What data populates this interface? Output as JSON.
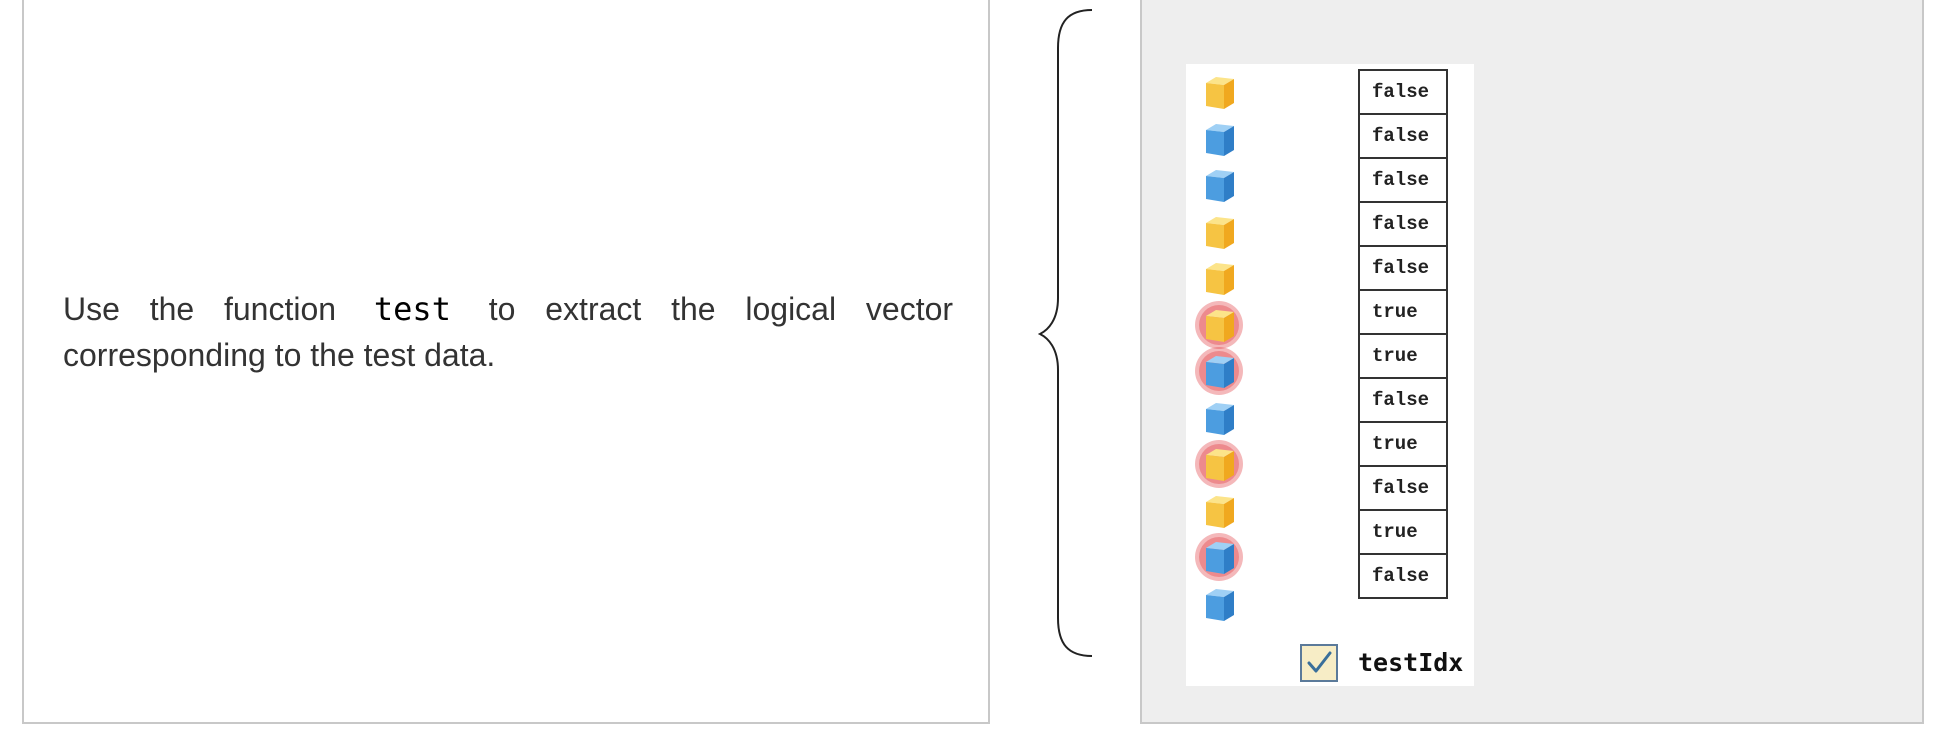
{
  "instruction": {
    "before": "Use the function",
    "code": "test",
    "after": "to extract the logical vector corresponding to the test data."
  },
  "vector": {
    "values": [
      "false",
      "false",
      "false",
      "false",
      "false",
      "true",
      "true",
      "false",
      "true",
      "false",
      "true",
      "false"
    ],
    "cube_colors": [
      "yellow",
      "blue",
      "blue",
      "yellow",
      "yellow",
      "yellow",
      "blue",
      "blue",
      "yellow",
      "yellow",
      "blue",
      "blue"
    ],
    "highlighted": [
      false,
      false,
      false,
      false,
      false,
      true,
      true,
      false,
      true,
      false,
      true,
      false
    ],
    "colors": {
      "yellow": "#f5b82e",
      "blue": "#3d8fd6",
      "highlight": "#e0353a"
    }
  },
  "variable": {
    "name": "testIdx",
    "icon": "checkbox-check-icon"
  }
}
